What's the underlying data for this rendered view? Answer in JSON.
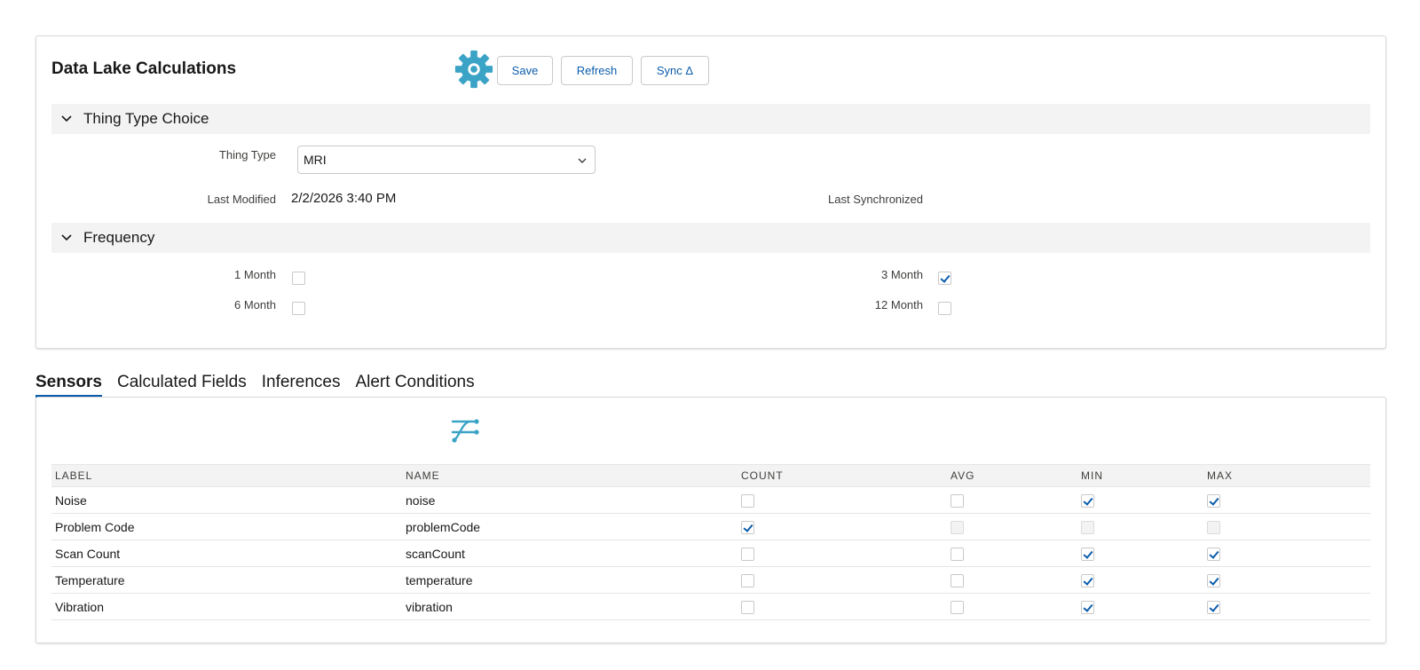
{
  "card": {
    "title": "Data Lake Calculations",
    "buttons": {
      "save": "Save",
      "refresh": "Refresh",
      "sync": "Sync Δ"
    }
  },
  "thing_type_section": {
    "header": "Thing Type Choice",
    "thing_type_label": "Thing Type",
    "thing_type_value": "MRI",
    "last_modified_label": "Last Modified",
    "last_modified_value": "2/2/2026 3:40 PM",
    "last_synchronized_label": "Last Synchronized",
    "last_synchronized_value": ""
  },
  "frequency_section": {
    "header": "Frequency",
    "options": [
      {
        "label": "1 Month",
        "checked": false
      },
      {
        "label": "3 Month",
        "checked": true
      },
      {
        "label": "6 Month",
        "checked": false
      },
      {
        "label": "12 Month",
        "checked": false
      }
    ]
  },
  "tabs": [
    {
      "label": "Sensors",
      "active": true
    },
    {
      "label": "Calculated Fields",
      "active": false
    },
    {
      "label": "Inferences",
      "active": false
    },
    {
      "label": "Alert Conditions",
      "active": false
    }
  ],
  "sensors_table": {
    "columns": [
      "LABEL",
      "NAME",
      "COUNT",
      "AVG",
      "MIN",
      "MAX"
    ],
    "rows": [
      {
        "label": "Noise",
        "name": "noise",
        "count": "unchecked",
        "avg": "unchecked",
        "min": "checked",
        "max": "checked"
      },
      {
        "label": "Problem Code",
        "name": "problemCode",
        "count": "checked",
        "avg": "disabled",
        "min": "disabled",
        "max": "disabled"
      },
      {
        "label": "Scan Count",
        "name": "scanCount",
        "count": "unchecked",
        "avg": "unchecked",
        "min": "checked",
        "max": "checked"
      },
      {
        "label": "Temperature",
        "name": "temperature",
        "count": "unchecked",
        "avg": "unchecked",
        "min": "checked",
        "max": "checked"
      },
      {
        "label": "Vibration",
        "name": "vibration",
        "count": "unchecked",
        "avg": "unchecked",
        "min": "checked",
        "max": "checked"
      }
    ]
  },
  "colors": {
    "accent": "#0b5cab",
    "icon_blue": "#3ba3c6",
    "section_bg": "#f3f3f3"
  },
  "icons": {
    "settings": "gear-icon",
    "mapping": "field-mapping-icon"
  }
}
